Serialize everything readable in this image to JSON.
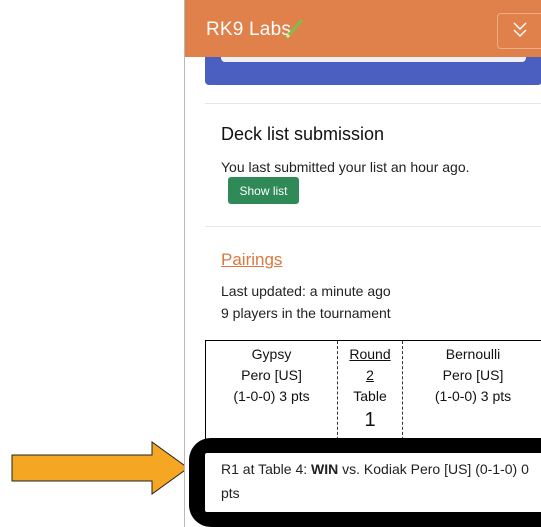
{
  "navbar": {
    "brand": "RK9 Labs",
    "brand_color": "#e0814b",
    "pencil_icon": "pencil-icon",
    "toggle_icon": "chevron-double-down-icon"
  },
  "deck": {
    "title": "Deck list submission",
    "text": "You last submitted your list an hour ago.",
    "button": "Show list"
  },
  "pairings": {
    "link": "Pairings",
    "updated": "Last updated: a minute ago",
    "players": "9 players in the tournament"
  },
  "match": {
    "player1": {
      "first": "Gypsy",
      "last": "Pero [US]",
      "record": "(1-0-0) 3 pts"
    },
    "round_label": "Round",
    "round_number": "2",
    "table_label": "Table",
    "table_number": "1",
    "player2": {
      "first": "Bernoulli",
      "last": "Pero [US]",
      "record": "(1-0-0) 3 pts"
    }
  },
  "result": {
    "prefix": "R1 at Table 4: ",
    "outcome": "WIN",
    "rest": " vs. Kodiak Pero [US] (0-1-0) 0 pts"
  },
  "annotation": {
    "arrow_color": "#f5a623"
  }
}
